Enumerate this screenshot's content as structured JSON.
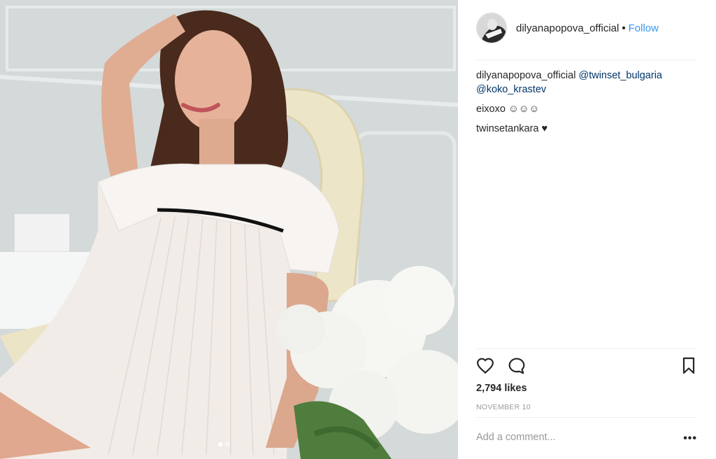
{
  "post": {
    "author": "dilyanapopova_official",
    "separator": "•",
    "follow_label": "Follow",
    "likes": "2,794 likes",
    "date": "NOVEMBER 10"
  },
  "caption": {
    "author": "dilyanapopova_official",
    "mention_1": "@twinset_bulgaria",
    "mention_2": "@koko_krastev"
  },
  "comments": [
    {
      "text": "eixoxo ☺☺☺"
    },
    {
      "text": "twinsetankara ♥"
    }
  ],
  "comment_form": {
    "placeholder": "Add a comment...",
    "more_label": "•••"
  },
  "carousel": {
    "count": 2,
    "active_index": 0
  },
  "icons": [
    "heart-icon",
    "comment-icon",
    "bookmark-icon"
  ],
  "colors": {
    "link": "#3897f0",
    "mention": "#003569",
    "meta": "#999999"
  }
}
